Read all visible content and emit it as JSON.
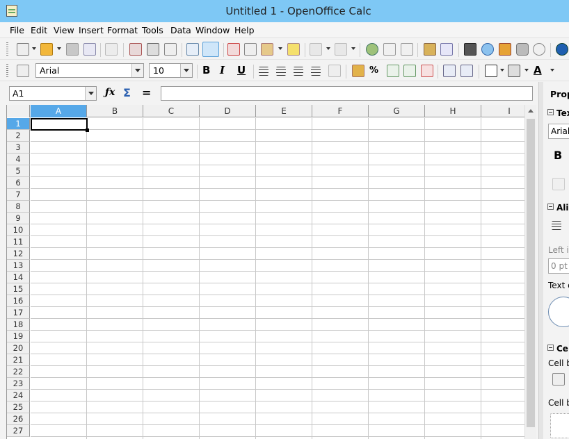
{
  "window": {
    "title": "Untitled 1 - OpenOffice Calc"
  },
  "menu": [
    "File",
    "Edit",
    "View",
    "Insert",
    "Format",
    "Tools",
    "Data",
    "Window",
    "Help"
  ],
  "formatting": {
    "font_name": "Arial",
    "font_size": "10"
  },
  "formula_bar": {
    "name_box": "A1",
    "input": ""
  },
  "columns": [
    "A",
    "B",
    "C",
    "D",
    "E",
    "F",
    "G",
    "H",
    "I"
  ],
  "rows": [
    "1",
    "2",
    "3",
    "4",
    "5",
    "6",
    "7",
    "8",
    "9",
    "10",
    "11",
    "12",
    "13",
    "14",
    "15",
    "16",
    "17",
    "18",
    "19",
    "20",
    "21",
    "22",
    "23",
    "24",
    "25",
    "26",
    "27"
  ],
  "selected_cell": "A1",
  "sidebar": {
    "title": "Prop",
    "text_section": "Tex",
    "font_field": "Arial",
    "bold_label": "B",
    "alignment_section": "Alig",
    "left_indent_label": "Left in",
    "indent_value": "0 pt",
    "text_orientation_label": "Text o",
    "cell_section": "Cel",
    "cell_bg_label": "Cell b",
    "cell_border_label": "Cell b"
  },
  "colors": {
    "titlebar": "#7ec8f5",
    "selection": "#56a8e8"
  }
}
